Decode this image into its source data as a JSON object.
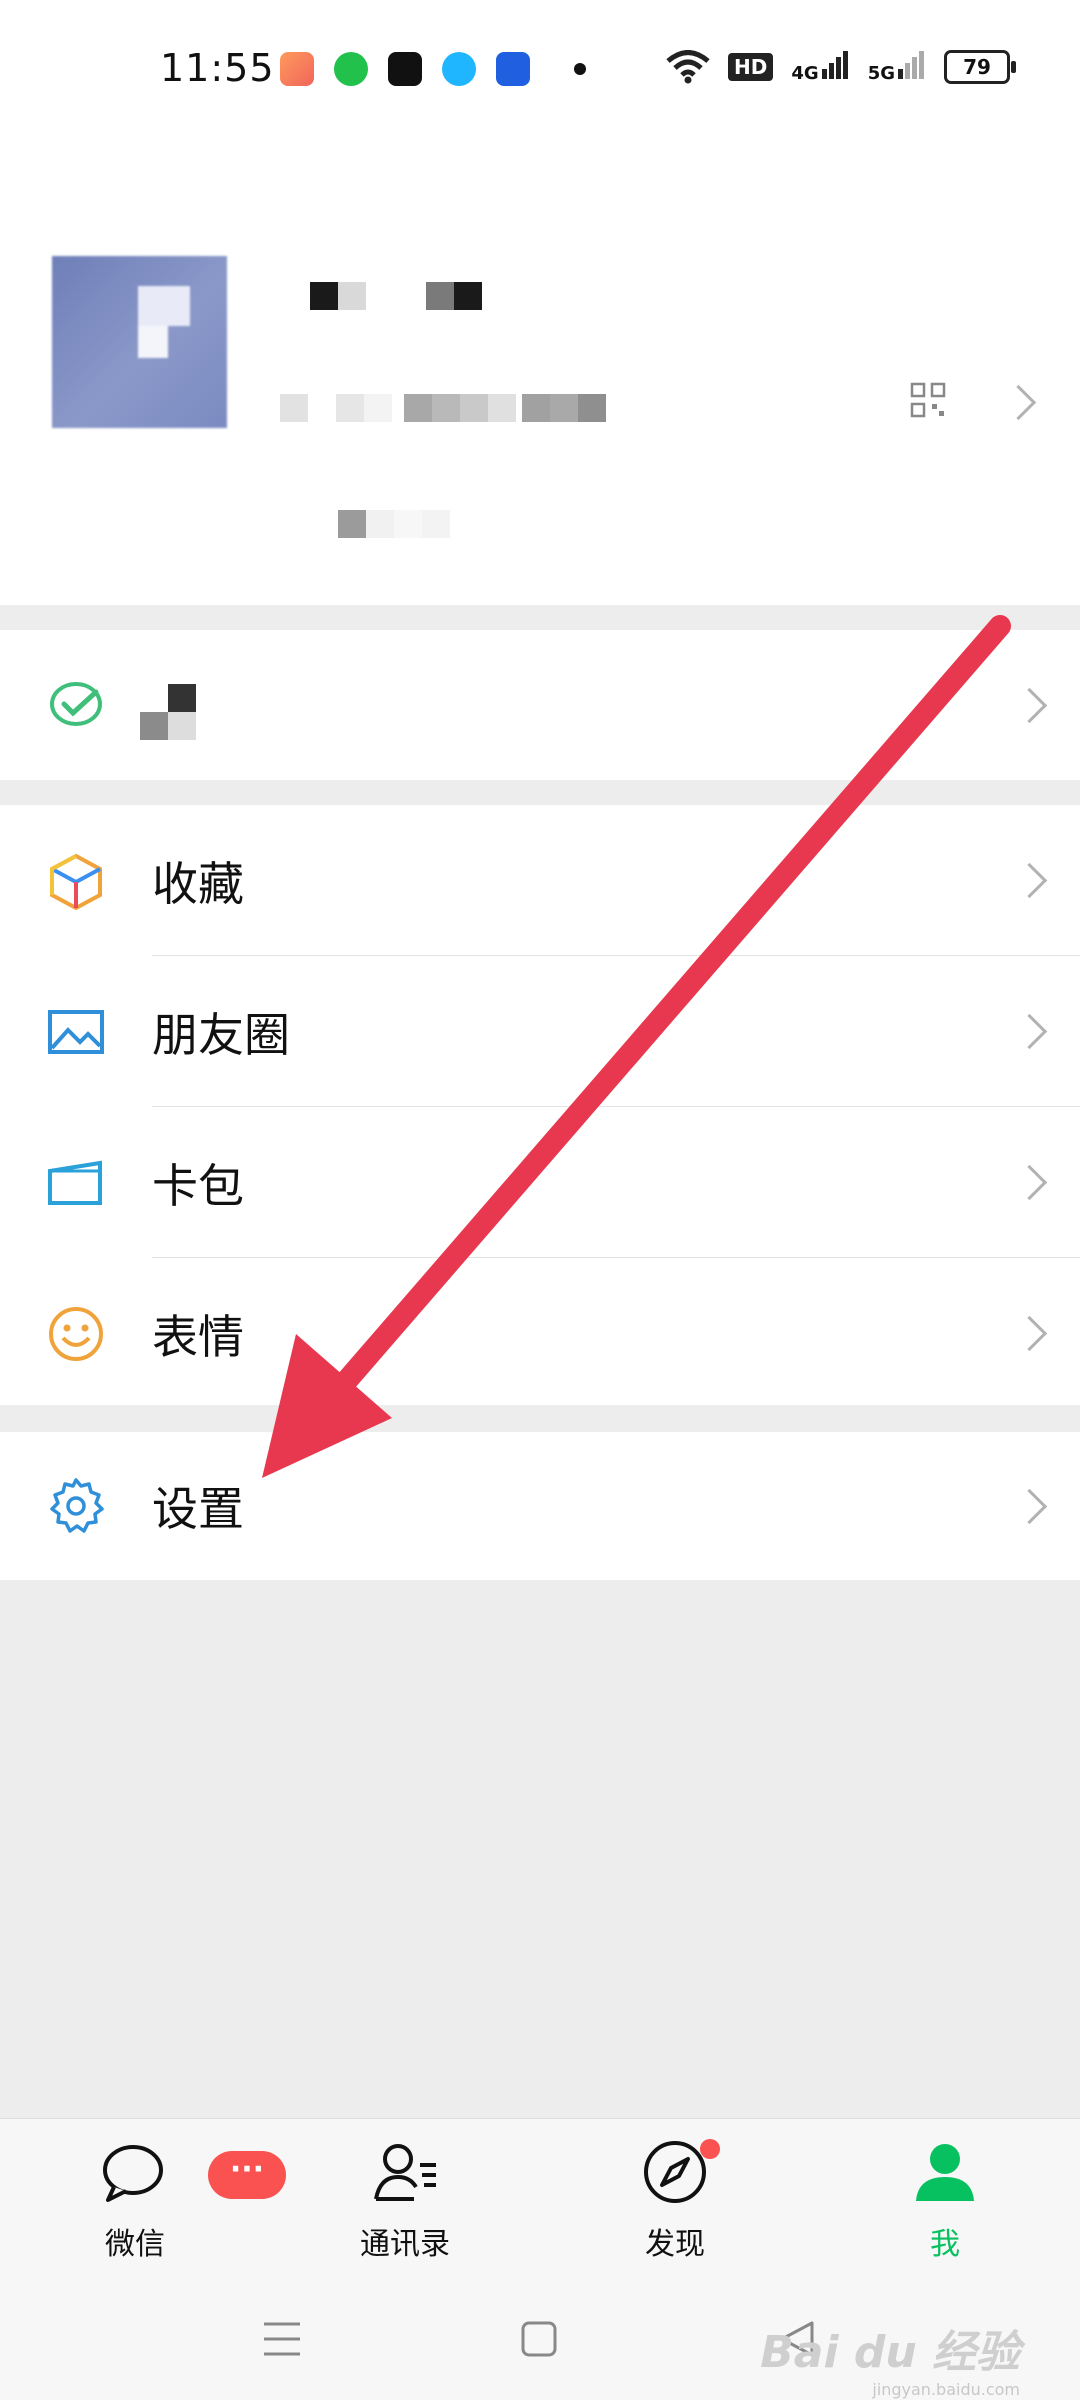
{
  "status_bar": {
    "time": "11:55",
    "hd_label": "HD",
    "net1": "4G",
    "net2": "5G",
    "battery": "79"
  },
  "menu": {
    "items": [
      {
        "label": "收藏",
        "icon": "favorites-cube-icon"
      },
      {
        "label": "朋友圈",
        "icon": "moments-photo-icon"
      },
      {
        "label": "卡包",
        "icon": "card-wallet-icon"
      },
      {
        "label": "表情",
        "icon": "smiley-sticker-icon"
      }
    ],
    "settings_label": "设置"
  },
  "tabbar": {
    "tabs": [
      {
        "label": "微信",
        "badge": "···"
      },
      {
        "label": "通讯录"
      },
      {
        "label": "发现"
      },
      {
        "label": "我"
      }
    ]
  },
  "watermark": {
    "text": "Bai du 经验",
    "sub": "jingyan.baidu.com"
  },
  "colors": {
    "accent_green": "#07c160",
    "badge_red": "#fa5151",
    "arrow_red": "#e8384f"
  }
}
